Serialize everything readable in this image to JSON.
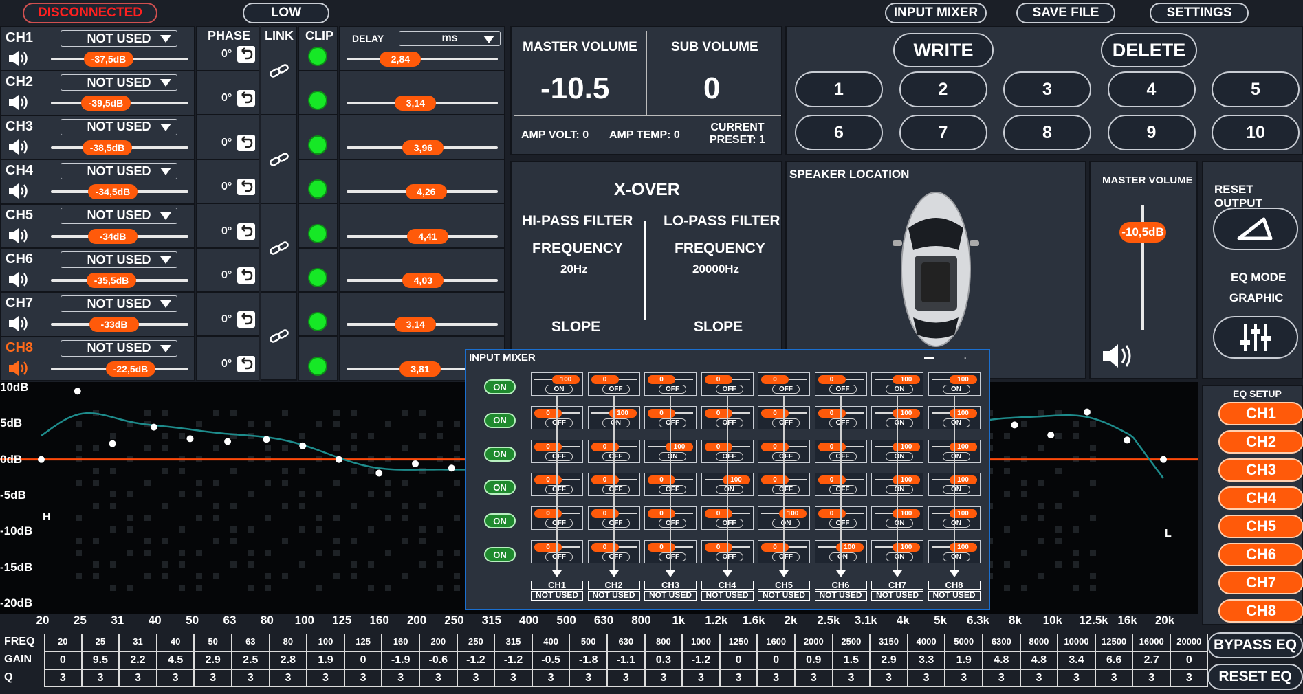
{
  "topbar": {
    "status": "DISCONNECTED",
    "mode": "LOW",
    "input_mixer": "INPUT MIXER",
    "save_file": "SAVE FILE",
    "settings": "SETTINGS"
  },
  "colors": {
    "accent": "#ff5a0a",
    "status": "#ff2020",
    "clip_led": "#16e826",
    "eq_curve": "#1e8c8c"
  },
  "channels_header": {
    "phase": "PHASE",
    "link": "LINK",
    "clip": "CLIP",
    "delay": "DELAY",
    "delay_unit": "ms"
  },
  "channels": [
    {
      "name": "CH1",
      "source": "NOT USED",
      "level": "-37,5dB",
      "level_frac": 0.42,
      "phase": "0°",
      "delay": "2,84",
      "delay_frac": 0.22
    },
    {
      "name": "CH2",
      "source": "NOT USED",
      "level": "-39,5dB",
      "level_frac": 0.4,
      "phase": "0°",
      "delay": "3,14",
      "delay_frac": 0.32
    },
    {
      "name": "CH3",
      "source": "NOT USED",
      "level": "-38,5dB",
      "level_frac": 0.41,
      "phase": "0°",
      "delay": "3,96",
      "delay_frac": 0.37
    },
    {
      "name": "CH4",
      "source": "NOT USED",
      "level": "-34,5dB",
      "level_frac": 0.45,
      "phase": "0°",
      "delay": "4,26",
      "delay_frac": 0.39
    },
    {
      "name": "CH5",
      "source": "NOT USED",
      "level": "-34dB",
      "level_frac": 0.45,
      "phase": "0°",
      "delay": "4,41",
      "delay_frac": 0.4
    },
    {
      "name": "CH6",
      "source": "NOT USED",
      "level": "-35,5dB",
      "level_frac": 0.44,
      "phase": "0°",
      "delay": "4,03",
      "delay_frac": 0.37
    },
    {
      "name": "CH7",
      "source": "NOT USED",
      "level": "-33dB",
      "level_frac": 0.46,
      "phase": "0°",
      "delay": "3,14",
      "delay_frac": 0.32
    },
    {
      "name": "CH8",
      "source": "NOT USED",
      "level": "-22,5dB",
      "level_frac": 0.58,
      "phase": "0°",
      "delay": "3,81",
      "delay_frac": 0.35
    }
  ],
  "volume": {
    "master_label": "MASTER VOLUME",
    "master_value": "-10.5",
    "sub_label": "SUB VOLUME",
    "sub_value": "0",
    "amp_volt": "AMP VOLT: 0",
    "amp_temp": "AMP TEMP: 0",
    "current_preset_1": "CURRENT",
    "current_preset_2": "PRESET: 1"
  },
  "presets": {
    "write": "WRITE",
    "delete": "DELETE",
    "numbers": [
      "1",
      "2",
      "3",
      "4",
      "5",
      "6",
      "7",
      "8",
      "9",
      "10"
    ]
  },
  "xover": {
    "title": "X-OVER",
    "hp_label": "HI-PASS FILTER",
    "lp_label": "LO-PASS FILTER",
    "freq_label": "FREQUENCY",
    "hp_freq": "20Hz",
    "lp_freq": "20000Hz",
    "slope_label": "SLOPE"
  },
  "speaker": {
    "label": "SPEAKER LOCATION"
  },
  "master_slider": {
    "label": "MASTER VOLUME",
    "value": "-10,5dB",
    "level_frac": 0.78
  },
  "right_panel": {
    "reset_output": "RESET OUTPUT",
    "eq_mode": "EQ MODE",
    "eq_mode_value": "GRAPHIC"
  },
  "eq_setup": {
    "label": "EQ SETUP",
    "channels": [
      "CH1",
      "CH2",
      "CH3",
      "CH4",
      "CH5",
      "CH6",
      "CH7",
      "CH8"
    ],
    "bypass": "BYPASS EQ",
    "reset": "RESET EQ"
  },
  "graph": {
    "y_labels": [
      "10dB",
      "5dB",
      "0dB",
      "-5dB",
      "-10dB",
      "-15dB",
      "-20dB"
    ],
    "x_labels": [
      "20",
      "25",
      "31",
      "40",
      "50",
      "63",
      "80",
      "100",
      "125",
      "160",
      "200",
      "250",
      "315",
      "400",
      "500",
      "630",
      "800",
      "1k",
      "1.2k",
      "1.6k",
      "2k",
      "2.5k",
      "3.1k",
      "4k",
      "5k",
      "6.3k",
      "8k",
      "10k",
      "12.5k",
      "16k",
      "20k"
    ],
    "hp_marker": "H",
    "lp_marker": "L"
  },
  "eq_table": {
    "row_labels": [
      "FREQ",
      "GAIN",
      "Q"
    ],
    "freq": [
      "20",
      "25",
      "31",
      "40",
      "50",
      "63",
      "80",
      "100",
      "125",
      "160",
      "200",
      "250",
      "315",
      "400",
      "500",
      "630",
      "800",
      "1000",
      "1250",
      "1600",
      "2000",
      "2500",
      "3150",
      "4000",
      "5000",
      "6300",
      "8000",
      "10000",
      "12500",
      "16000",
      "20000"
    ],
    "gain": [
      "0",
      "9.5",
      "2.2",
      "4.5",
      "2.9",
      "2.5",
      "2.8",
      "1.9",
      "0",
      "-1.9",
      "-0.6",
      "-1.2",
      "-1.2",
      "-0.5",
      "-1.8",
      "-1.1",
      "0.3",
      "-1.2",
      "0",
      "0",
      "0.9",
      "1.5",
      "2.9",
      "3.3",
      "1.9",
      "4.8",
      "4.8",
      "3.4",
      "6.6",
      "2.7",
      "0"
    ],
    "q": [
      "3",
      "3",
      "3",
      "3",
      "3",
      "3",
      "3",
      "3",
      "3",
      "3",
      "3",
      "3",
      "3",
      "3",
      "3",
      "3",
      "3",
      "3",
      "3",
      "3",
      "3",
      "3",
      "3",
      "3",
      "3",
      "3",
      "3",
      "3",
      "3",
      "3",
      "3"
    ]
  },
  "mixer": {
    "title": "INPUT MIXER",
    "min_icon": "minimize-icon",
    "close_icon": "close-icon",
    "on_label": "ON",
    "off_label": "OFF",
    "rows": [
      [
        "100",
        "0",
        "0",
        "0",
        "0",
        "0",
        "100",
        "100"
      ],
      [
        "0",
        "100",
        "0",
        "0",
        "0",
        "0",
        "100",
        "100"
      ],
      [
        "0",
        "0",
        "100",
        "0",
        "0",
        "0",
        "100",
        "100"
      ],
      [
        "0",
        "0",
        "0",
        "100",
        "0",
        "0",
        "100",
        "100"
      ],
      [
        "0",
        "0",
        "0",
        "0",
        "100",
        "0",
        "100",
        "100"
      ],
      [
        "0",
        "0",
        "0",
        "0",
        "0",
        "100",
        "100",
        "100"
      ]
    ],
    "outputs": [
      "CH1",
      "CH2",
      "CH3",
      "CH4",
      "CH5",
      "CH6",
      "CH7",
      "CH8"
    ],
    "output_source": "NOT USED"
  }
}
